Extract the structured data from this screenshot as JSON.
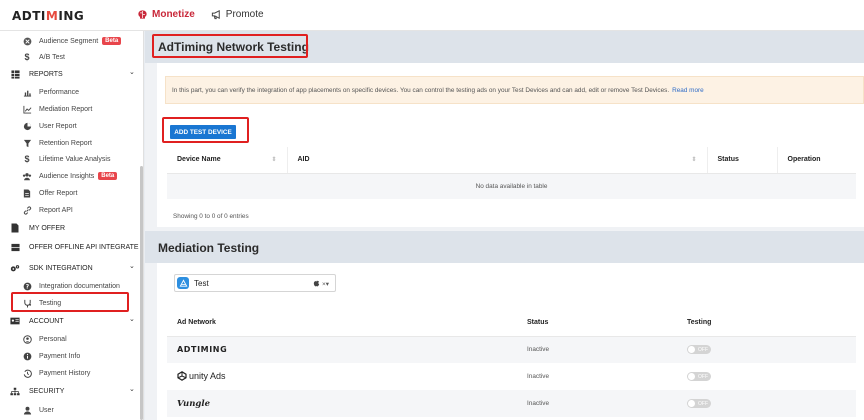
{
  "header": {
    "logo_text_a": "ADTI",
    "logo_text_b": "M",
    "logo_text_c": "ING",
    "nav": [
      {
        "label": "Monetize",
        "icon": "brain-icon",
        "active": true
      },
      {
        "label": "Promote",
        "icon": "megaphone-icon",
        "active": false
      }
    ]
  },
  "sidebar": {
    "audience_segment": "Audience Segment",
    "beta": "Beta",
    "ab_test": "A/B Test",
    "reports": "REPORTS",
    "performance": "Performance",
    "mediation_report": "Mediation Report",
    "user_report": "User Report",
    "retention_report": "Retention Report",
    "ltv": "Lifetime Value Analysis",
    "audience_insights": "Audience Insights",
    "offer_report": "Offer Report",
    "report_api": "Report API",
    "my_offer": "MY OFFER",
    "offer_offline": "OFFER OFFLINE API INTEGRATE",
    "sdk_integration": "SDK INTEGRATION",
    "integration_docs": "Integration documentation",
    "testing": "Testing",
    "account": "ACCOUNT",
    "personal": "Personal",
    "payment_info": "Payment Info",
    "payment_history": "Payment History",
    "security": "SECURITY",
    "user": "User"
  },
  "network_testing": {
    "title": "AdTiming Network Testing",
    "info_text": "In this part, you can verify the integration of app placements on specific devices. You can control the testing ads on your Test Devices and can add, edit or remove Test Devices.",
    "info_link": "Read more",
    "add_button": "ADD TEST DEVICE",
    "columns": [
      "Device Name",
      "AID",
      "Status",
      "Operation"
    ],
    "empty": "No data available in table",
    "entries": "Showing 0 to 0 of 0 entries"
  },
  "mediation_testing": {
    "title": "Mediation Testing",
    "app_name": "Test",
    "selector_suffix": "×▾",
    "columns": [
      "Ad Network",
      "Status",
      "Testing"
    ],
    "rows": [
      {
        "network": "ADTIMING",
        "status": "Inactive",
        "toggle": "OFF"
      },
      {
        "network": "unity Ads",
        "status": "Inactive",
        "toggle": "OFF"
      },
      {
        "network": "Vungle",
        "status": "Inactive",
        "toggle": "OFF"
      }
    ]
  },
  "colors": {
    "accent": "#c9283a",
    "button": "#1976d2",
    "highlight": "#e02020"
  }
}
